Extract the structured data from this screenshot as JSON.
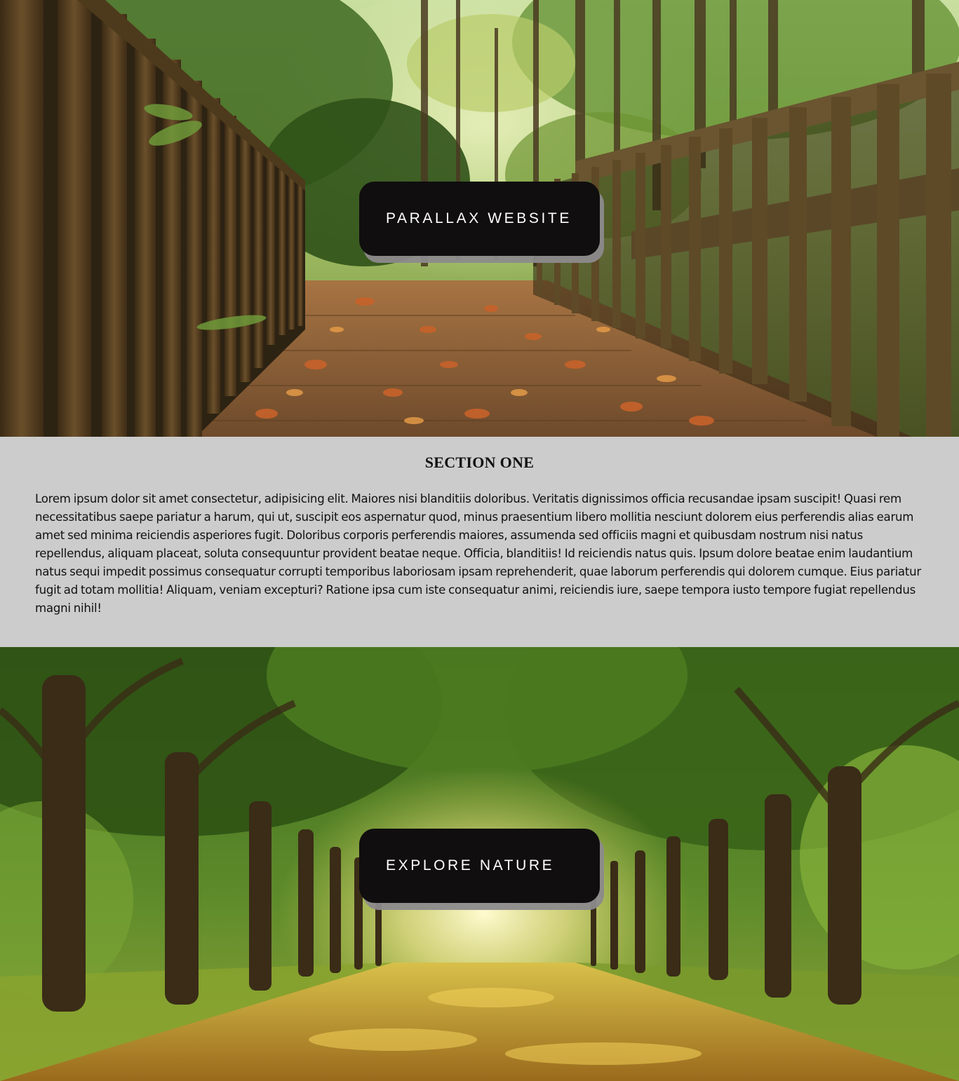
{
  "hero_top": {
    "caption": "PARALLAX WEBSITE"
  },
  "section_one": {
    "title": "SECTION ONE",
    "body": "Lorem ipsum dolor sit amet consectetur, adipisicing elit. Maiores nisi blanditiis doloribus. Veritatis dignissimos officia recusandae ipsam suscipit! Quasi rem necessitatibus saepe pariatur a harum, qui ut, suscipit eos aspernatur quod, minus praesentium libero mollitia nesciunt dolorem eius perferendis alias earum amet sed minima reiciendis asperiores fugit. Doloribus corporis perferendis maiores, assumenda sed officiis magni et quibusdam nostrum nisi natus repellendus, aliquam placeat, soluta consequuntur provident beatae neque. Officia, blanditiis! Id reiciendis natus quis. Ipsum dolore beatae enim laudantium natus sequi impedit possimus consequatur corrupti temporibus laboriosam ipsam reprehenderit, quae laborum perferendis qui dolorem cumque. Eius pariatur fugit ad totam mollitia! Aliquam, veniam excepturi? Ratione ipsa cum iste consequatur animi, reiciendis iure, saepe tempora iusto tempore fugiat repellendus magni nihil!"
  },
  "hero_bottom": {
    "caption": "EXPLORE NATURE"
  }
}
